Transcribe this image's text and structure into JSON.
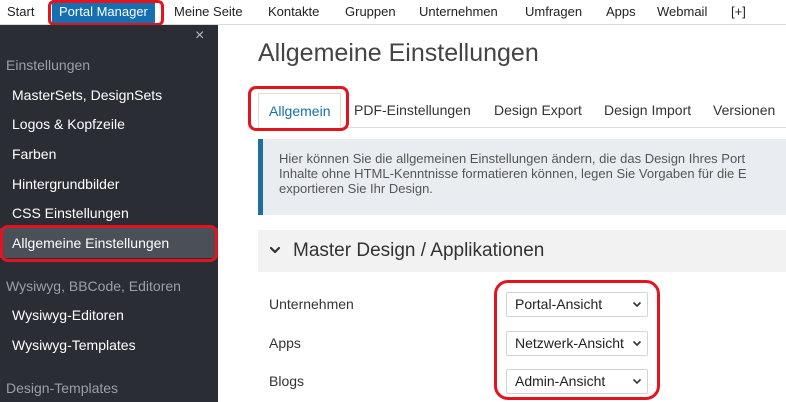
{
  "topnav": {
    "items": [
      {
        "label": "Start"
      },
      {
        "label": "Portal Manager"
      },
      {
        "label": "Meine Seite"
      },
      {
        "label": "Kontakte"
      },
      {
        "label": "Gruppen"
      },
      {
        "label": "Unternehmen"
      },
      {
        "label": "Umfragen"
      },
      {
        "label": "Apps"
      },
      {
        "label": "Webmail"
      },
      {
        "label": "[+]"
      }
    ],
    "active_index": 1
  },
  "sidebar": {
    "close_glyph": "×",
    "sections": [
      {
        "title": "Einstellungen",
        "items": [
          "MasterSets, DesignSets",
          "Logos & Kopfzeile",
          "Farben",
          "Hintergrundbilder",
          "CSS Einstellungen",
          "Allgemeine Einstellungen"
        ]
      },
      {
        "title": "Wysiwyg, BBCode, Editoren",
        "items": [
          "Wysiwyg-Editoren",
          "Wysiwyg-Templates"
        ]
      },
      {
        "title": "Design-Templates",
        "items": []
      }
    ],
    "active_item": "Allgemeine Einstellungen"
  },
  "main": {
    "title": "Allgemeine Einstellungen",
    "tabs": [
      "Allgemein",
      "PDF-Einstellungen",
      "Design Export",
      "Design Import",
      "Versionen"
    ],
    "active_tab": "Allgemein",
    "info": {
      "line1": "Hier können Sie die allgemeinen Einstellungen ändern, die das Design Ihres Port",
      "line2": "Inhalte ohne HTML-Kenntnisse formatieren können, legen Sie Vorgaben für die E",
      "line3": "exportieren Sie Ihr Design."
    },
    "section": {
      "title": "Master Design / Applikationen",
      "icon": "chevron-down-icon"
    },
    "fields": [
      {
        "label": "Unternehmen",
        "value": "Portal-Ansicht"
      },
      {
        "label": "Apps",
        "value": "Netzwerk-Ansicht"
      },
      {
        "label": "Blogs",
        "value": "Admin-Ansicht"
      }
    ]
  },
  "colors": {
    "accent": "#1470b0",
    "sidebar_bg": "#2a2d33",
    "highlight": "#e4141e"
  }
}
